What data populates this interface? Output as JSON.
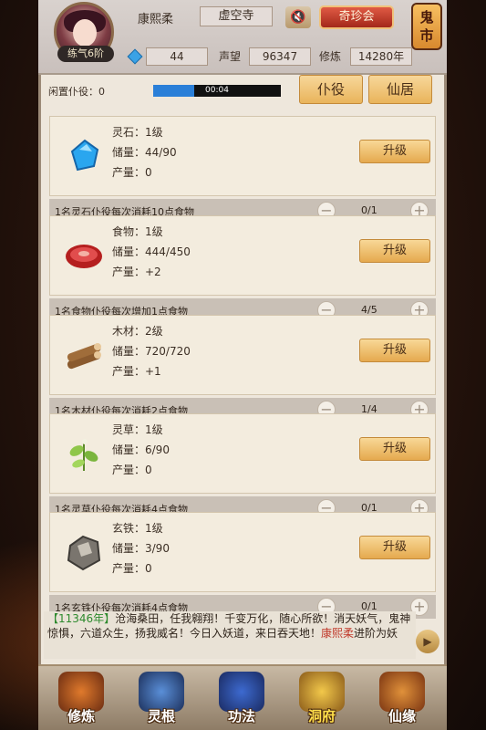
{
  "header": {
    "player_name": "康熙柔",
    "location": "虚空寺",
    "treasure_label": "奇珍会",
    "ghost_market_label": "鬼市",
    "rank": "练气6阶",
    "gems": "44",
    "reputation_label": "声望",
    "reputation": "96347",
    "cultivation_label": "修炼",
    "cultivation": "14280年"
  },
  "idle": {
    "label": "闲置仆役：0",
    "timer": "00:04",
    "progress_percent": 32
  },
  "top_buttons": {
    "servant": "仆役",
    "immortal_residence": "仙居"
  },
  "upgrade_label": "升级",
  "resources": [
    {
      "icon": "spirit-stone-icon",
      "name": "灵石：1级",
      "storage": "储量：44/90",
      "output": "产量：0",
      "servant_text": "1名灵石仆役每次消耗10点食物",
      "servant_count": "0/1"
    },
    {
      "icon": "food-icon",
      "name": "食物：1级",
      "storage": "储量：444/450",
      "output": "产量：+2",
      "servant_text": "1名食物仆役每次增加1点食物",
      "servant_count": "4/5"
    },
    {
      "icon": "wood-icon",
      "name": "木材：2级",
      "storage": "储量：720/720",
      "output": "产量：+1",
      "servant_text": "1名木材仆役每次消耗2点食物",
      "servant_count": "1/4"
    },
    {
      "icon": "herb-icon",
      "name": "灵草：1级",
      "storage": "储量：6/90",
      "output": "产量：0",
      "servant_text": "1名灵草仆役每次消耗4点食物",
      "servant_count": "0/1"
    },
    {
      "icon": "iron-icon",
      "name": "玄铁：1级",
      "storage": "储量：3/90",
      "output": "产量：0",
      "servant_text": "1名玄铁仆役每次消耗4点食物",
      "servant_count": "0/1"
    }
  ],
  "chat": {
    "tag": "【11346年】",
    "text1": "沧海桑田，任我翱翔！千变万化，随心所欲！消天妖气，鬼神惊惧，六道众生，扬我威名！今日入妖道，来日吞天地！",
    "name": "康熙柔",
    "text2": "进阶为妖"
  },
  "nav": [
    "修炼",
    "灵根",
    "功法",
    "洞府",
    "仙缘"
  ],
  "colors": {
    "accent_orange": "#e9b45b",
    "treasure_red": "#c0392b",
    "timer_blue": "#2a7fd8",
    "nav_active": "#ffde4a"
  }
}
